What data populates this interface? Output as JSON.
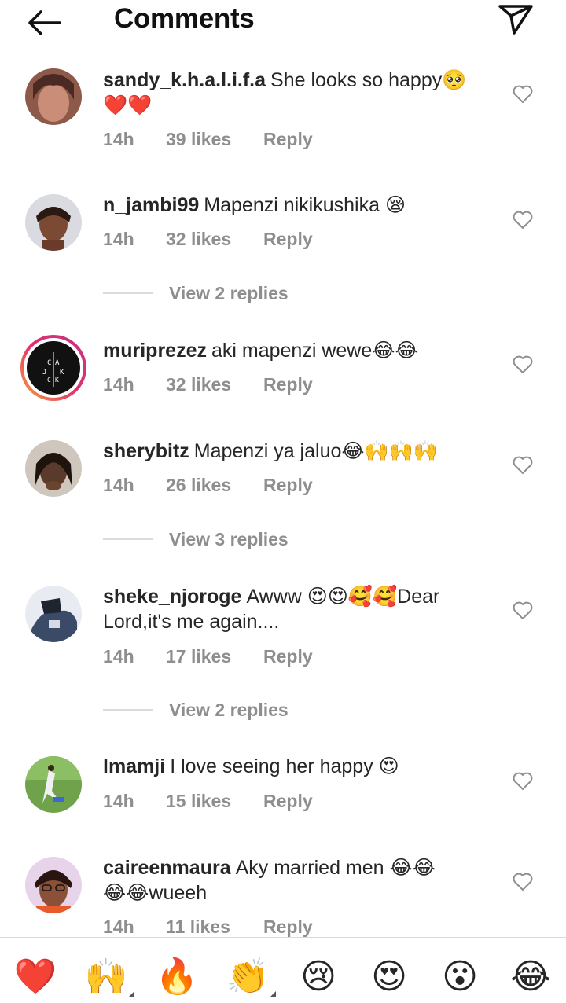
{
  "header": {
    "title": "Comments"
  },
  "comments": [
    {
      "username": "sandy_k.h.a.l.i.f.a",
      "text": "She looks so happy🥺",
      "text2": "❤️❤️",
      "time": "14h",
      "likes": "39 likes",
      "reply": "Reply"
    },
    {
      "username": "n_jambi99",
      "text": "Mapenzi nikikushika 😪",
      "time": "14h",
      "likes": "32 likes",
      "reply": "Reply",
      "view_replies": "View 2 replies"
    },
    {
      "username": "muriprezez",
      "text": "aki mapenzi wewe😂😂",
      "time": "14h",
      "likes": "32 likes",
      "reply": "Reply"
    },
    {
      "username": "sherybitz",
      "text": "Mapenzi ya jaluo😂🙌🙌🙌",
      "time": "14h",
      "likes": "26 likes",
      "reply": "Reply",
      "view_replies": "View 3 replies"
    },
    {
      "username": "sheke_njoroge",
      "text": "Awww 😍😍🥰🥰Dear",
      "text2": "Lord,it's me again....",
      "time": "14h",
      "likes": "17 likes",
      "reply": "Reply",
      "view_replies": "View 2 replies"
    },
    {
      "username": "lmamji",
      "text": "I love seeing her happy 😍",
      "time": "14h",
      "likes": "15 likes",
      "reply": "Reply"
    },
    {
      "username": "caireenmaura",
      "text": "Aky married men 😂😂",
      "text2": "😂😂wueeh",
      "time": "14h",
      "likes": "11 likes",
      "reply": "Reply"
    }
  ],
  "avatar_texts": {
    "muriprezez": [
      "C",
      "A",
      "J",
      "K",
      "C",
      "K"
    ]
  },
  "emoji_bar": {
    "emojis": [
      "❤️",
      "🙌",
      "🔥",
      "👏",
      "😢",
      "😍",
      "😮",
      "😂"
    ]
  },
  "colors": {
    "muted": "#8e8e8e",
    "text": "#262626",
    "divider": "#dbdbdb",
    "story_ring": "#e1306c"
  }
}
